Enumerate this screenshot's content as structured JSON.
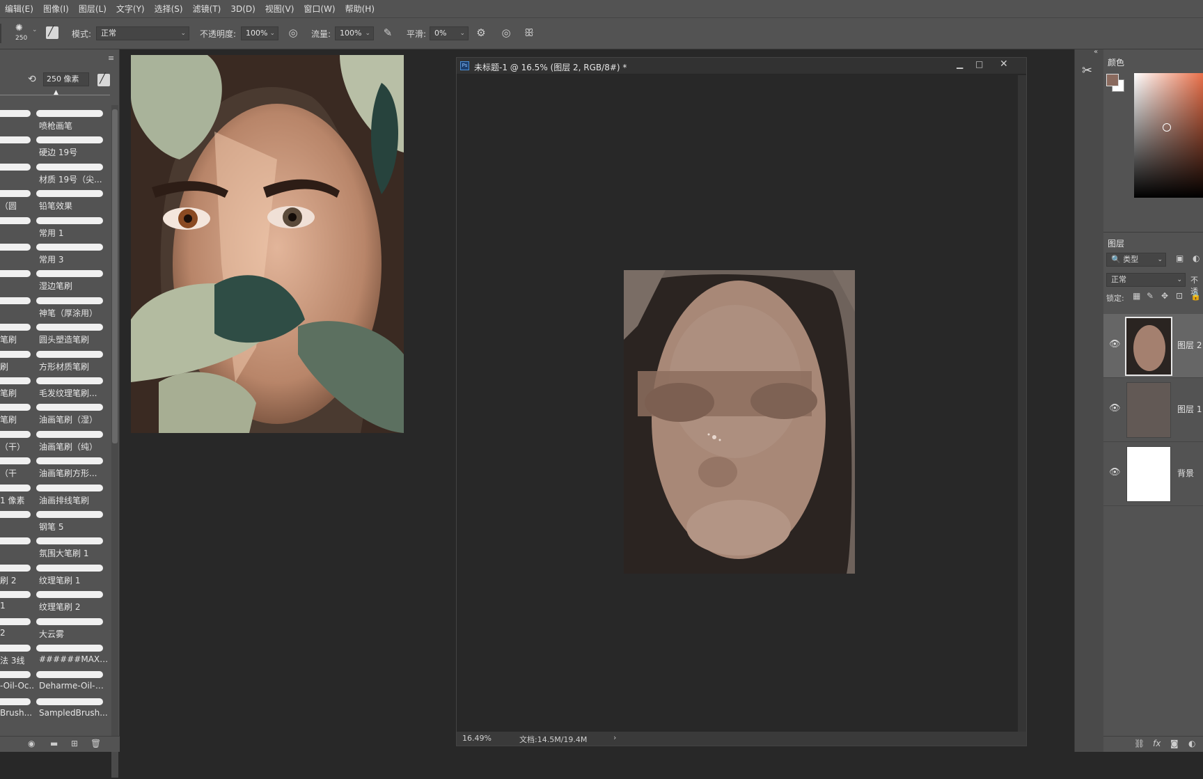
{
  "menu": [
    "编辑(E)",
    "图像(I)",
    "图层(L)",
    "文字(Y)",
    "选择(S)",
    "滤镜(T)",
    "3D(D)",
    "视图(V)",
    "窗口(W)",
    "帮助(H)"
  ],
  "options": {
    "brush_size": "250",
    "mode_label": "模式:",
    "mode_value": "正常",
    "opacity_label": "不透明度:",
    "opacity_value": "100%",
    "flow_label": "流量:",
    "flow_value": "100%",
    "smooth_label": "平滑:",
    "smooth_value": "0%"
  },
  "brush_panel": {
    "size_value": "250 像素",
    "left_names": [
      "",
      "",
      "",
      "（圆",
      "",
      "",
      "",
      "",
      "笔刷",
      "刷",
      "笔刷",
      "笔刷",
      "（干）",
      "（干",
      "1 像素",
      "",
      "",
      "刷 2",
      "1",
      "2",
      "法 3线",
      "-Oil-Oc...",
      "Brush..."
    ],
    "right_names": [
      "喷枪画笔",
      "硬边 19号",
      "材质 19号（尖...",
      "铅笔效果",
      "常用 1",
      "常用 3",
      "湿边笔刷",
      "神笔（厚涂用）",
      "圆头塑造笔刷",
      "方形材质笔刷",
      "毛发纹理笔刷...",
      "油画笔刷（湿）",
      "油画笔刷（纯）",
      "油画笔刷方形...",
      "油画排线笔刷",
      "钢笔 5",
      "氛围大笔刷 1",
      "纹理笔刷 1",
      "纹理笔刷 2",
      "大云雾",
      "######MAXH...",
      "Deharme-Oil-Oc...",
      "SampledBrush..."
    ]
  },
  "document": {
    "title": "未标题-1 @ 16.5% (图层 2, RGB/8#) *",
    "zoom": "16.49%",
    "doc_size": "文档:14.5M/19.4M"
  },
  "color_panel": {
    "title": "颜色",
    "foreground": "#8a6a5e",
    "background": "#ffffff"
  },
  "layers_panel": {
    "title": "图层",
    "filter_label": "类型",
    "blend_mode": "正常",
    "opacity_label": "不透",
    "lock_label": "锁定:",
    "layers": [
      {
        "name": "图层 2",
        "selected": true
      },
      {
        "name": "图层 1",
        "selected": false
      },
      {
        "name": "背景",
        "selected": false
      }
    ]
  }
}
